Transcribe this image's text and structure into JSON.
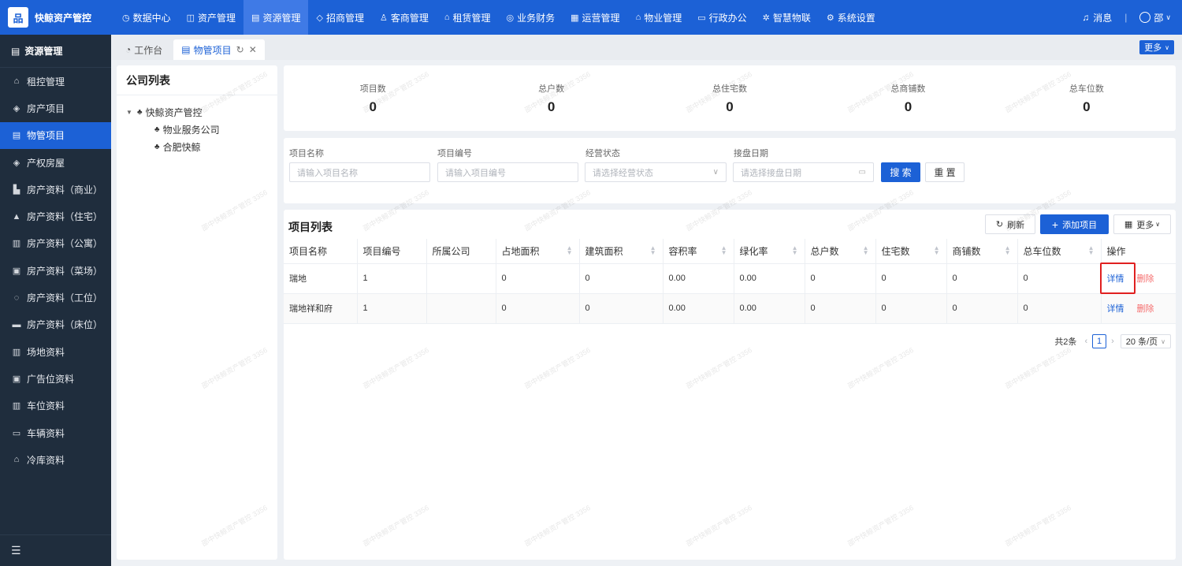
{
  "brand": {
    "logo": "品",
    "name": "快鲸资产管控"
  },
  "topnav": [
    {
      "icon": "◷",
      "label": "数据中心"
    },
    {
      "icon": "◫",
      "label": "资产管理"
    },
    {
      "icon": "▤",
      "label": "资源管理",
      "active": true
    },
    {
      "icon": "◇",
      "label": "招商管理"
    },
    {
      "icon": "♙",
      "label": "客商管理"
    },
    {
      "icon": "⌂",
      "label": "租赁管理"
    },
    {
      "icon": "◎",
      "label": "业务财务"
    },
    {
      "icon": "▦",
      "label": "运营管理"
    },
    {
      "icon": "⌂",
      "label": "物业管理"
    },
    {
      "icon": "▭",
      "label": "行政办公"
    },
    {
      "icon": "✲",
      "label": "智慧物联"
    },
    {
      "icon": "⚙",
      "label": "系统设置"
    }
  ],
  "topright": {
    "messages": "消息",
    "user": "邵"
  },
  "sidebar": {
    "header": "资源管理",
    "items": [
      {
        "icon": "⌂",
        "label": "租控管理"
      },
      {
        "icon": "◈",
        "label": "房产项目"
      },
      {
        "icon": "▤",
        "label": "物管项目",
        "active": true
      },
      {
        "icon": "◈",
        "label": "产权房屋"
      },
      {
        "icon": "▙",
        "label": "房产资料（商业）"
      },
      {
        "icon": "▲",
        "label": "房产资料（住宅）"
      },
      {
        "icon": "▥",
        "label": "房产资料（公寓）"
      },
      {
        "icon": "▣",
        "label": "房产资料（菜场）"
      },
      {
        "icon": "◌",
        "label": "房产资料（工位）"
      },
      {
        "icon": "▬",
        "label": "房产资料（床位）"
      },
      {
        "icon": "▥",
        "label": "场地资料"
      },
      {
        "icon": "▣",
        "label": "广告位资料"
      },
      {
        "icon": "▥",
        "label": "车位资料"
      },
      {
        "icon": "▭",
        "label": "车辆资料"
      },
      {
        "icon": "⌂",
        "label": "冷库资料"
      }
    ],
    "footer_icon": "☰"
  },
  "tabs": [
    {
      "label": "工作台",
      "icon": "◔"
    },
    {
      "label": "物管项目",
      "icon": "▤",
      "active": true
    }
  ],
  "tabs_more": "更多",
  "company": {
    "title": "公司列表",
    "root": "快鲸资产管控",
    "children": [
      "物业服务公司",
      "合肥快鲸"
    ]
  },
  "stats": [
    {
      "label": "项目数",
      "value": "0"
    },
    {
      "label": "总户数",
      "value": "0"
    },
    {
      "label": "总住宅数",
      "value": "0"
    },
    {
      "label": "总商铺数",
      "value": "0"
    },
    {
      "label": "总车位数",
      "value": "0"
    }
  ],
  "filters": {
    "name_label": "项目名称",
    "name_placeholder": "请输入项目名称",
    "code_label": "项目编号",
    "code_placeholder": "请输入项目编号",
    "status_label": "经营状态",
    "status_placeholder": "请选择经营状态",
    "date_label": "接盘日期",
    "date_placeholder": "请选择接盘日期",
    "search": "搜 索",
    "reset": "重 置"
  },
  "list": {
    "title": "项目列表",
    "refresh": "刷新",
    "add": "添加项目",
    "more": "更多",
    "columns": [
      "项目名称",
      "项目编号",
      "所属公司",
      "占地面积",
      "建筑面积",
      "容积率",
      "绿化率",
      "总户数",
      "住宅数",
      "商铺数",
      "总车位数",
      "操作"
    ],
    "rows": [
      [
        "瑞地",
        "1",
        "",
        "0",
        "0",
        "0.00",
        "0.00",
        "0",
        "0",
        "0",
        "0"
      ],
      [
        "瑞地祥和府",
        "1",
        "",
        "0",
        "0",
        "0.00",
        "0.00",
        "0",
        "0",
        "0",
        "0"
      ]
    ],
    "op_view": "详情",
    "op_delete": "删除"
  },
  "pager": {
    "total": "共2条",
    "page": "1",
    "size": "20 条/页"
  },
  "watermark": "邵中快鲸资产管控 3356"
}
